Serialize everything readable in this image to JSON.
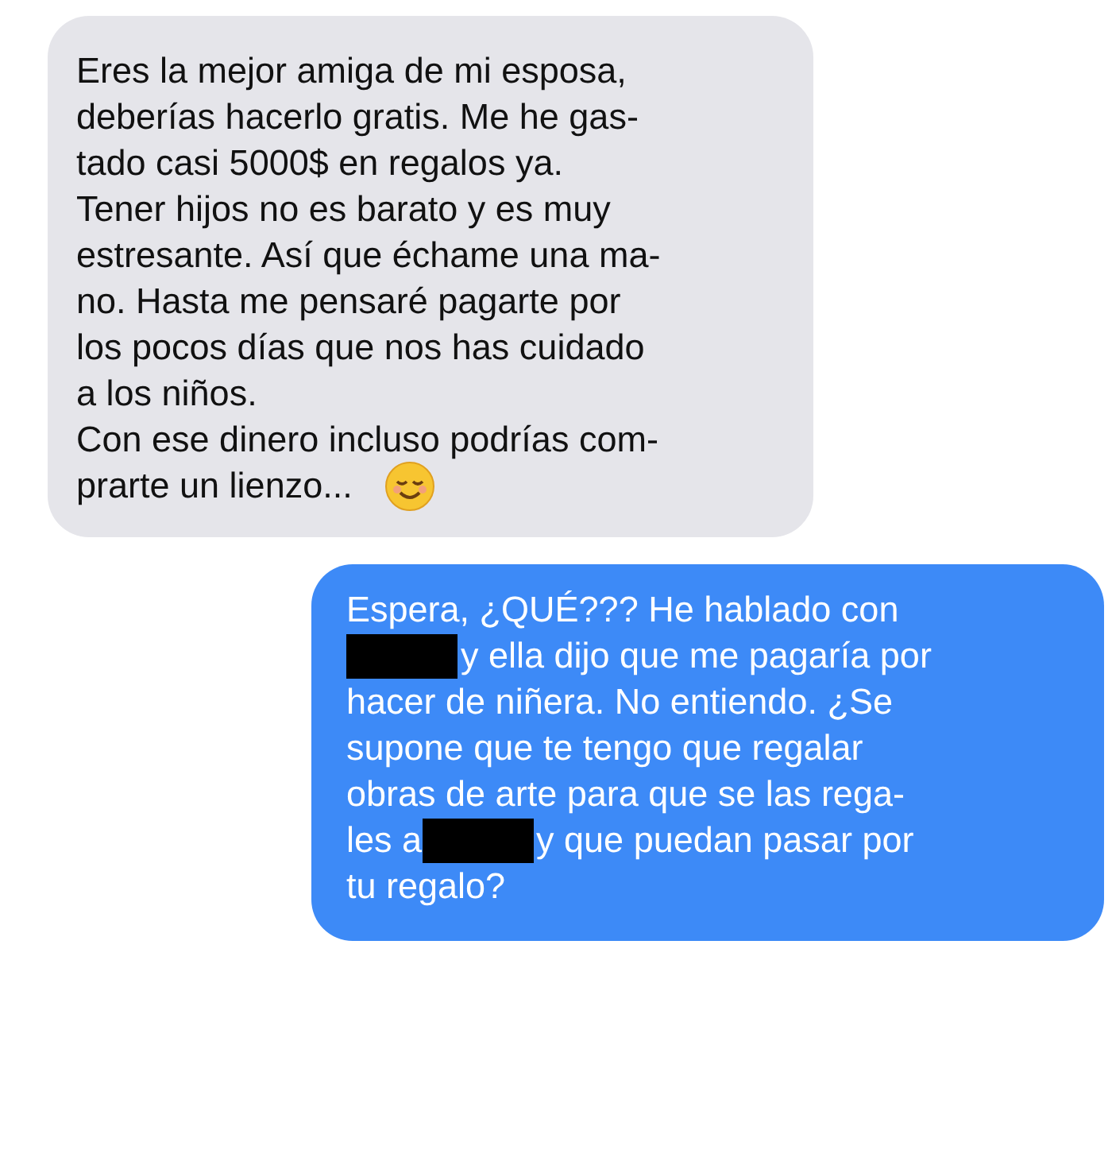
{
  "messages": [
    {
      "kind": "received",
      "lines": [
        [
          {
            "kind": "text",
            "text": "Eres la mejor amiga de mi esposa,"
          }
        ],
        [
          {
            "kind": "text",
            "text": "deberías hacerlo gratis. Me he gas-"
          }
        ],
        [
          {
            "kind": "text",
            "text": "tado casi 5000$ en regalos ya."
          }
        ],
        [
          {
            "kind": "text",
            "text": "Tener hijos no es barato y es muy"
          }
        ],
        [
          {
            "kind": "text",
            "text": "estresante. Así que échame una ma-"
          }
        ],
        [
          {
            "kind": "text",
            "text": "no. Hasta me pensaré pagarte por"
          }
        ],
        [
          {
            "kind": "text",
            "text": "los pocos días que nos has cuidado"
          }
        ],
        [
          {
            "kind": "text",
            "text": "a los niños."
          }
        ],
        [
          {
            "kind": "text",
            "text": "Con ese dinero incluso podrías com-"
          }
        ],
        [
          {
            "kind": "text",
            "text": "prarte un lienzo..."
          },
          {
            "kind": "emoji"
          }
        ]
      ]
    },
    {
      "kind": "sent",
      "lines": [
        [
          {
            "kind": "text",
            "text": "Espera, ¿QUÉ??? He hablado con"
          }
        ],
        [
          {
            "kind": "redacted"
          },
          {
            "kind": "text",
            "text": "y ella dijo que me pagaría por"
          }
        ],
        [
          {
            "kind": "text",
            "text": "hacer de niñera. No entiendo. ¿Se"
          }
        ],
        [
          {
            "kind": "text",
            "text": "supone que te tengo que regalar"
          }
        ],
        [
          {
            "kind": "text",
            "text": "obras de arte para que se las rega-"
          }
        ],
        [
          {
            "kind": "text",
            "text": "les a"
          },
          {
            "kind": "redacted"
          },
          {
            "kind": "text",
            "text": "y que puedan pasar por"
          }
        ],
        [
          {
            "kind": "text",
            "text": "tu regalo?"
          }
        ]
      ]
    }
  ]
}
